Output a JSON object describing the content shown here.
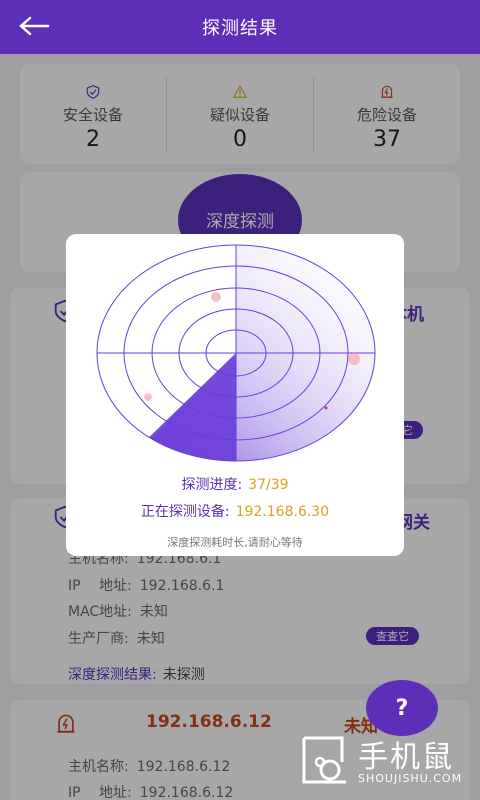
{
  "header": {
    "title": "探测结果"
  },
  "stats": [
    {
      "label": "安全设备",
      "count": "2",
      "icon": "shield-check-icon",
      "color": "#5b2fb7"
    },
    {
      "label": "疑似设备",
      "count": "0",
      "icon": "warning-icon",
      "color": "#d6a21f"
    },
    {
      "label": "危险设备",
      "count": "37",
      "icon": "danger-device-icon",
      "color": "#c0461c"
    }
  ],
  "deep_scan": {
    "label": "深度探测"
  },
  "devices": [
    {
      "tag": "本机",
      "action": "查查它"
    },
    {
      "tag": "网关",
      "host_label": "主机名称:",
      "host": "192.168.6.1",
      "ip_label": "IP　 地址:",
      "ip": "192.168.6.1",
      "mac_label": "MAC地址:",
      "mac": "未知",
      "vendor_label": "生产厂商:",
      "vendor": "未知",
      "action": "查查它",
      "result_label": "深度探测结果:",
      "result": "未探测"
    },
    {
      "ip_title": "192.168.6.12",
      "tag": "未知",
      "host_label": "主机名称:",
      "host": "192.168.6.12",
      "ip_label": "IP　 地址:",
      "ip": "192.168.6.12"
    }
  ],
  "modal": {
    "progress_label": "探测进度:",
    "progress": "37/39",
    "current_label": "正在探测设备:",
    "current": "192.168.6.30",
    "hint": "深度探测耗时长,请耐心等待"
  },
  "help": {
    "label": "?"
  },
  "watermark": {
    "text": "手机鼠",
    "sub": "SHOUJISHU.COM"
  },
  "colors": {
    "primary": "#5b2fb7",
    "accent": "#d6a21f",
    "danger": "#c0461c"
  }
}
